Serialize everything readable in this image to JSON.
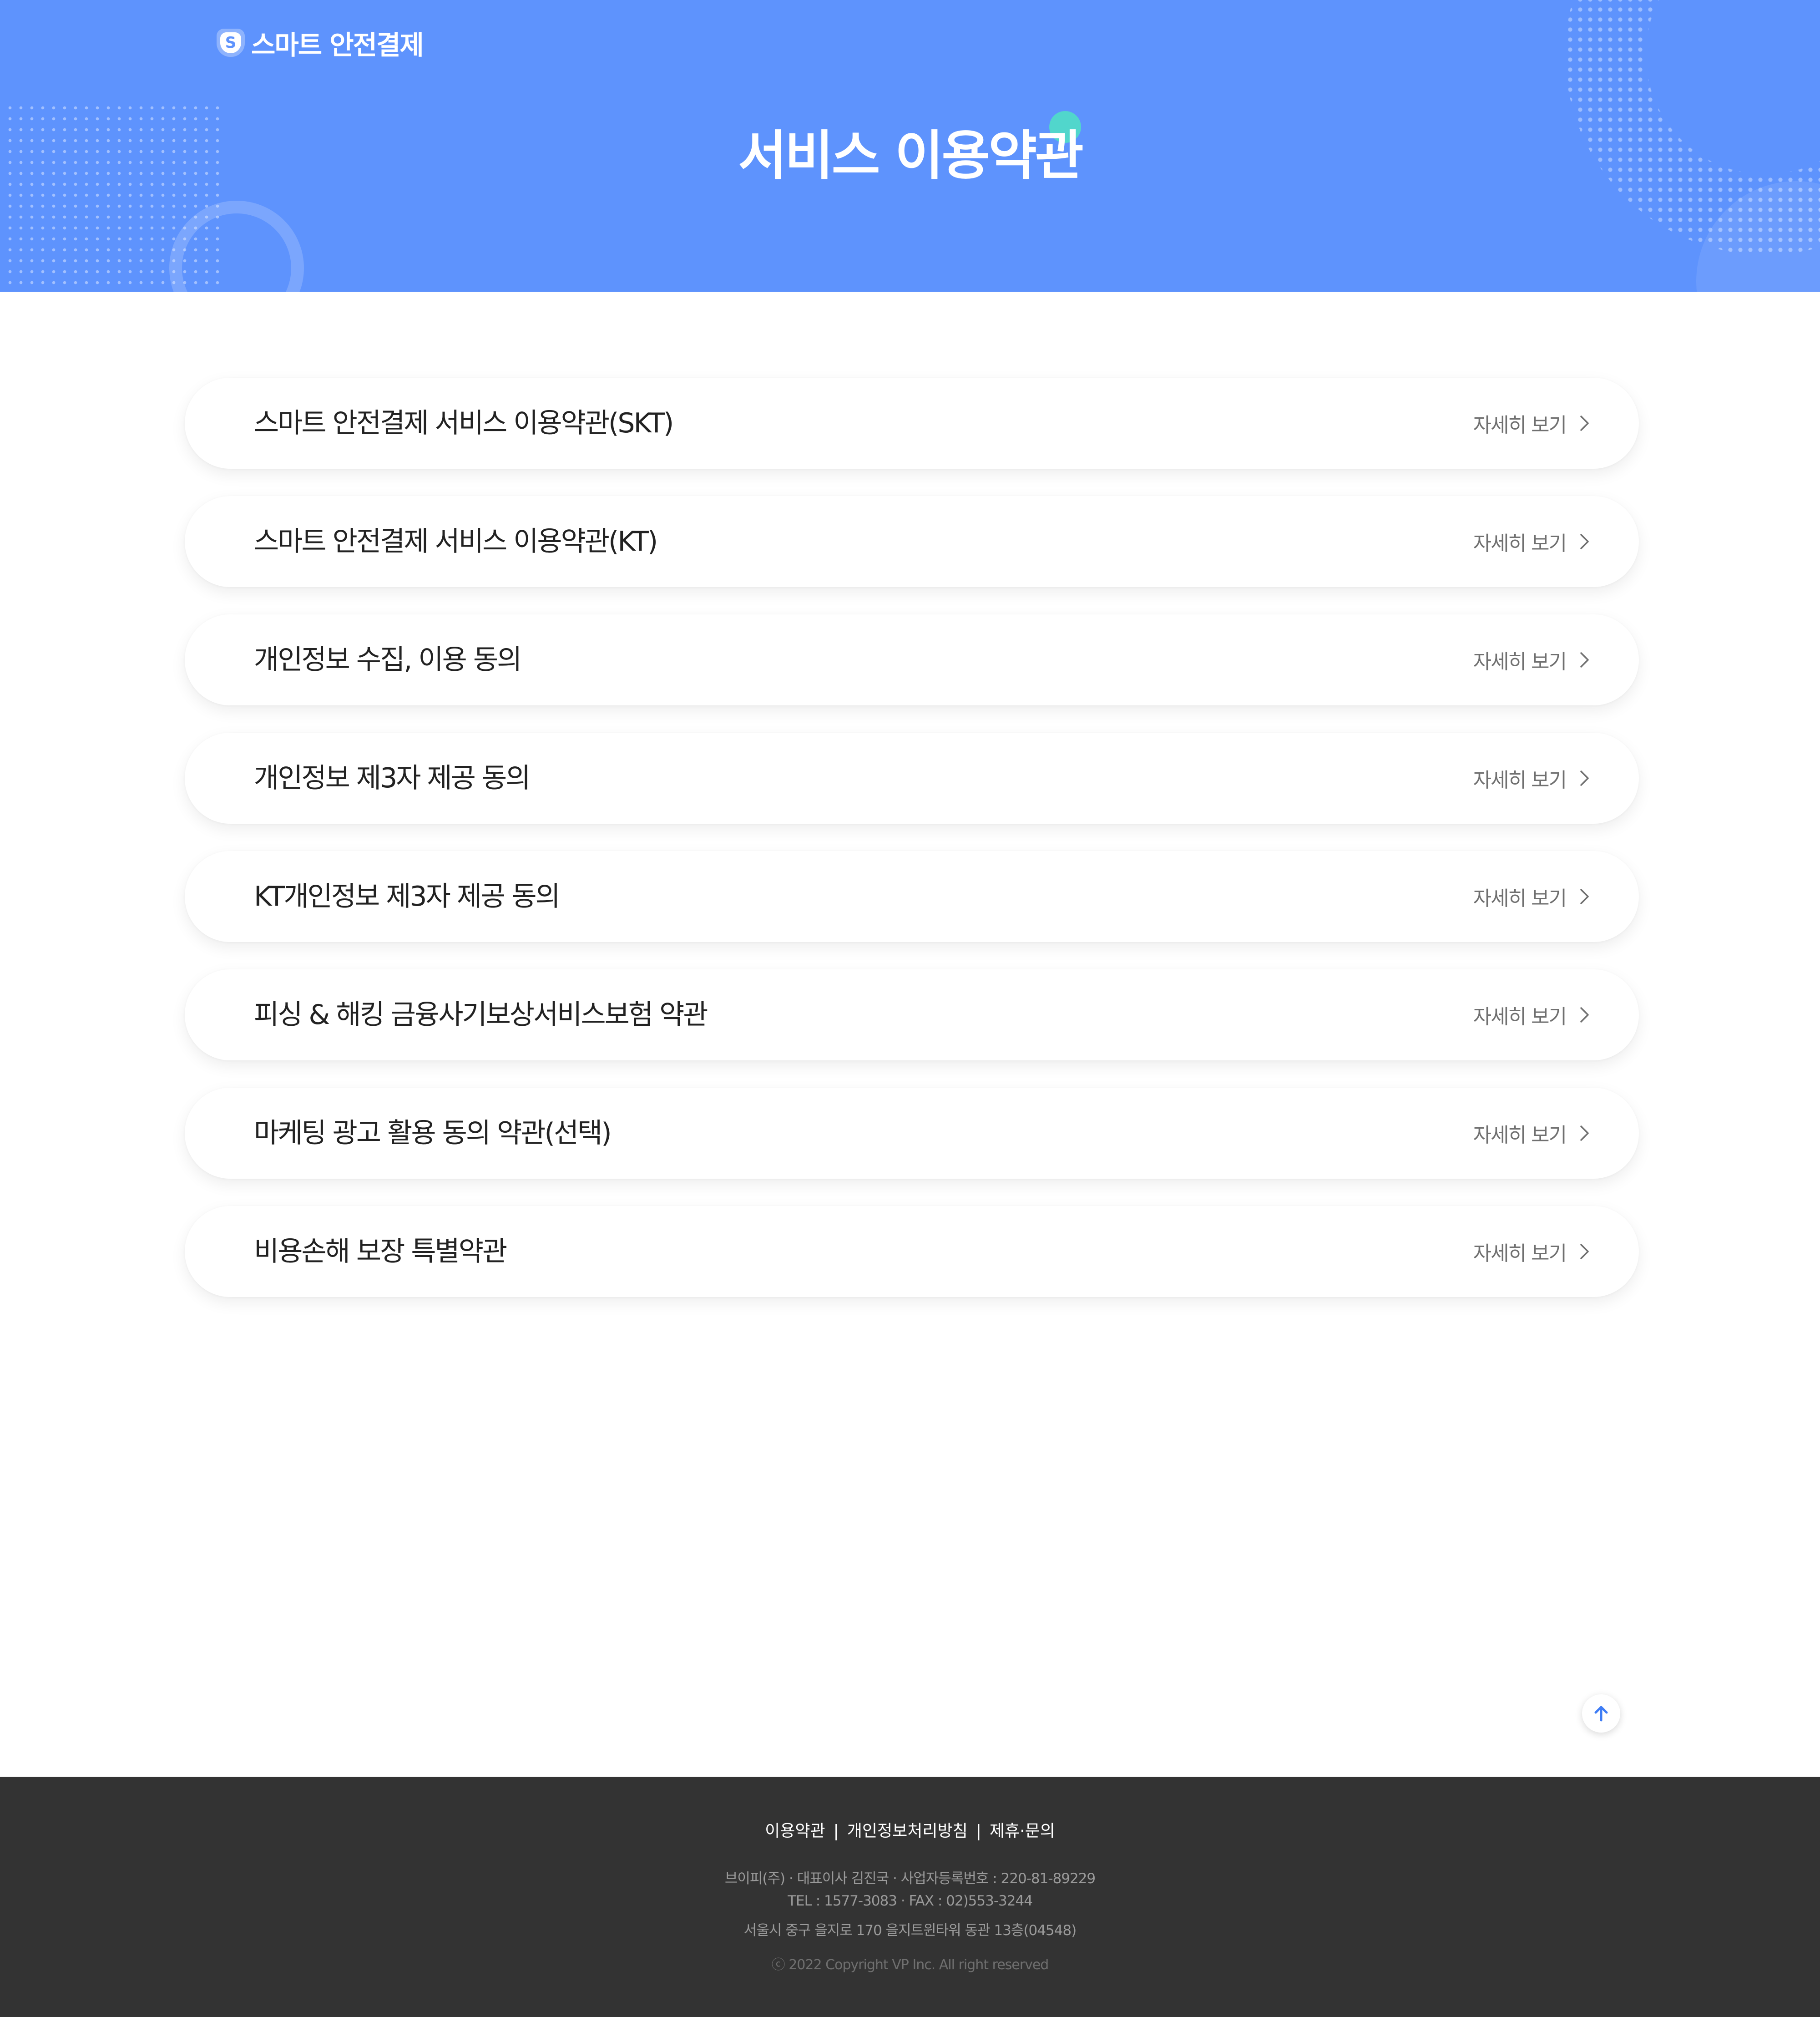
{
  "header": {
    "logo_badge": "S",
    "logo_text": "스마트 안전결제",
    "page_title": "서비스 이용약관",
    "bg_color": "#5e93fd",
    "accent_dot_color": "#51d6cc"
  },
  "terms": [
    {
      "title": "스마트 안전결제 서비스 이용약관(SKT)",
      "more_label": "자세히 보기"
    },
    {
      "title": "스마트 안전결제 서비스 이용약관(KT)",
      "more_label": "자세히 보기"
    },
    {
      "title": "개인정보 수집, 이용 동의",
      "more_label": "자세히 보기"
    },
    {
      "title": "개인정보 제3자 제공 동의",
      "more_label": "자세히 보기"
    },
    {
      "title": "KT개인정보 제3자 제공 동의",
      "more_label": "자세히 보기"
    },
    {
      "title": "피싱 & 해킹 금융사기보상서비스보험 약관",
      "more_label": "자세히 보기"
    },
    {
      "title": "마케팅 광고 활용 동의 약관(선택)",
      "more_label": "자세히 보기"
    },
    {
      "title": "비용손해 보장 특별약관",
      "more_label": "자세히 보기"
    }
  ],
  "top_button": {
    "icon": "arrow-up-icon",
    "color": "#3f7df5"
  },
  "footer": {
    "links": [
      "이용약관",
      "개인정보처리방침",
      "제휴·문의"
    ],
    "separator": "|",
    "info_line1": "브이피(주) · 대표이사 김진국 · 사업자등록번호 : 220-81-89229",
    "info_line2": "TEL : 1577-3083 · FAX : 02)553-3244",
    "info_line3": "서울시 중구 을지로 170 을지트윈타워 동관 13층(04548)",
    "copyright": "ⓒ 2022 Copyright VP Inc. All right reserved",
    "bg_color": "#333333"
  }
}
